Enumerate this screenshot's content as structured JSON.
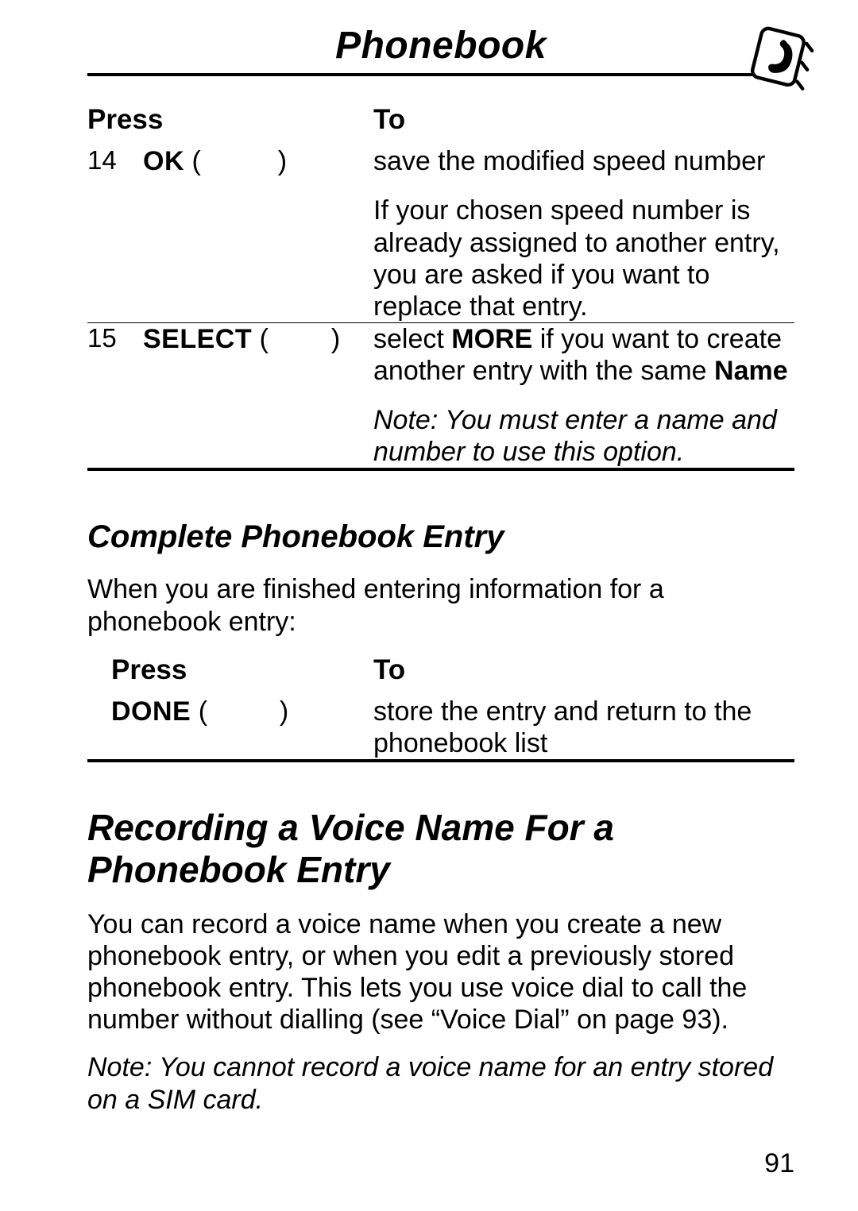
{
  "header": {
    "title": "Phonebook"
  },
  "table1": {
    "head_press": "Press",
    "head_to": "To",
    "rows": [
      {
        "step": "14",
        "key": "OK",
        "open": "(",
        "close": ")",
        "to_a": "save the modified speed number",
        "to_b": "If your chosen speed number is already assigned to another entry, you are asked if you want to replace that entry."
      },
      {
        "step": "15",
        "key": "SELECT",
        "open": "(",
        "close": ")",
        "to_a_pre": "select ",
        "to_a_more": "MORE",
        "to_a_mid": " if you want to create another entry with the same ",
        "to_a_name": "Name",
        "to_b_note": "Note: You must enter a name and number to use this option."
      }
    ]
  },
  "h2_complete": "Complete Phonebook Entry",
  "p_complete_intro": "When you are finished entering information for a phonebook entry:",
  "table2": {
    "head_press": "Press",
    "head_to": "To",
    "row": {
      "key": "DONE",
      "open": "(",
      "close": ")",
      "to": "store the entry and return to the phonebook list"
    }
  },
  "h1_voice": "Recording a Voice Name For a Phonebook Entry",
  "p_voice_body": "You can record a voice name when you create a new phonebook entry, or when you edit a previously stored phonebook entry. This lets you use voice dial to call the number without dialling (see “Voice Dial” on page 93).",
  "p_voice_note": "Note: You cannot record a voice name for an entry stored on a SIM card.",
  "page_number": "91"
}
